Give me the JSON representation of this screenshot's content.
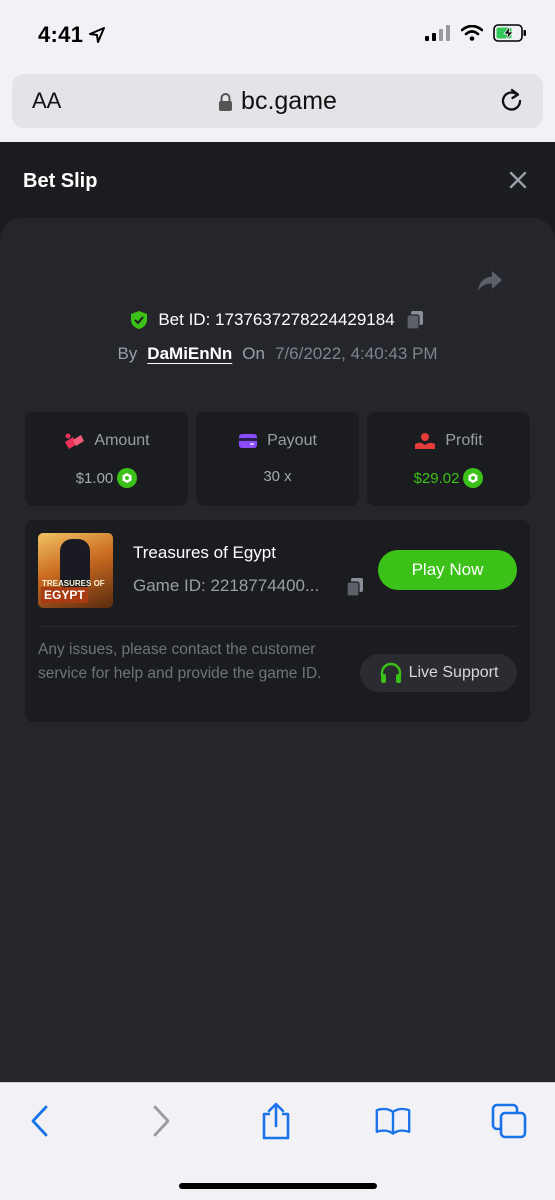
{
  "status_bar": {
    "time": "4:41"
  },
  "browser": {
    "text_size_label": "AA",
    "url": "bc.game"
  },
  "bet_slip": {
    "title": "Bet Slip",
    "bet_id_label": "Bet ID:",
    "bet_id": "1737637278224429184",
    "by_label": "By",
    "username": "DaMiEnNn",
    "on_label": "On",
    "date": "7/6/2022, 4:40:43 PM",
    "stats": [
      {
        "label": "Amount",
        "value": "$1.00",
        "icon": "amount-icon",
        "color": "#e9315a"
      },
      {
        "label": "Payout",
        "value": "30 x",
        "icon": "payout-icon",
        "color": "#8b4dfb"
      },
      {
        "label": "Profit",
        "value": "$29.02",
        "icon": "profit-icon",
        "color": "#e53b3b"
      }
    ],
    "game": {
      "thumbnail_text_top": "TREASURES OF",
      "thumbnail_text_bottom": "EGYPT",
      "name": "Treasures of Egypt",
      "game_id": "Game ID: 2218774400...",
      "play_label": "Play Now"
    },
    "issues_text": "Any issues, please contact the customer service for help and provide the game ID.",
    "live_support_label": "Live Support"
  },
  "colors": {
    "accent_green": "#3bc117",
    "panel": "#24262b",
    "card": "#1b1c20"
  }
}
